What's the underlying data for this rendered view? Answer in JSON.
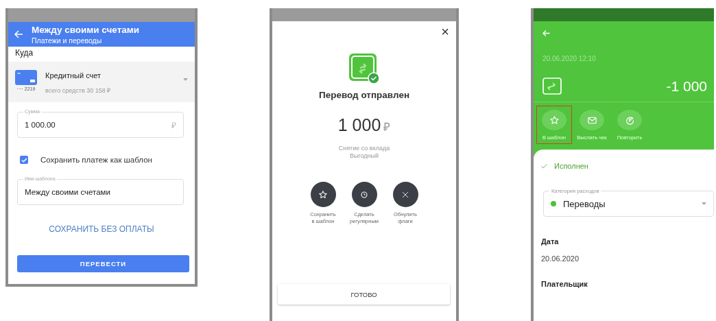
{
  "transfer_form": {
    "header": {
      "title": "Между своими счетами",
      "subtitle": "Платежи и переводы"
    },
    "section_label": "Куда",
    "account": {
      "name": "Кредитный счет",
      "balance": "всего средств 30 158 ₽",
      "card_number": "···· 2219"
    },
    "amount_field": {
      "label": "Сумма",
      "value": "1 000.00",
      "currency": "₽"
    },
    "save_template": {
      "label": "Сохранить платеж как шаблон",
      "checked": true
    },
    "template_name_field": {
      "label": "Имя шаблона",
      "value": "Между своими счетами"
    },
    "save_without_payment": "СОХРАНИТЬ БЕЗ ОПЛАТЫ",
    "submit_button": "ПЕРЕВЕСТИ"
  },
  "transfer_done": {
    "close": "×",
    "title": "Перевод отправлен",
    "amount": "1 000",
    "currency": "₽",
    "description": [
      "Снятие со вклада",
      "Выгодный"
    ],
    "actions": [
      {
        "kind": "star",
        "label": [
          "Сохранить",
          "в шаблон"
        ]
      },
      {
        "kind": "clock",
        "label": [
          "Сделать",
          "регулярным"
        ]
      },
      {
        "kind": "cross",
        "label": [
          "Обнулить",
          "флаги"
        ]
      }
    ],
    "done_button": "ГОТОВО"
  },
  "operation_details": {
    "datetime": "20.06.2020 12:10",
    "amount": "-1 000",
    "actions": [
      {
        "kind": "star",
        "label": "В шаблон",
        "highlighted": true
      },
      {
        "kind": "mail",
        "label": "Выслать чек",
        "highlighted": false
      },
      {
        "kind": "repeat",
        "label": "Повторить",
        "highlighted": false
      }
    ],
    "status": "Исполнен",
    "category_field": {
      "label": "Категория расходов",
      "value": "Переводы",
      "color": "#4cc23a"
    },
    "date": {
      "label": "Дата",
      "value": "20.06.2020"
    },
    "payer": {
      "label": "Плательщик"
    }
  }
}
